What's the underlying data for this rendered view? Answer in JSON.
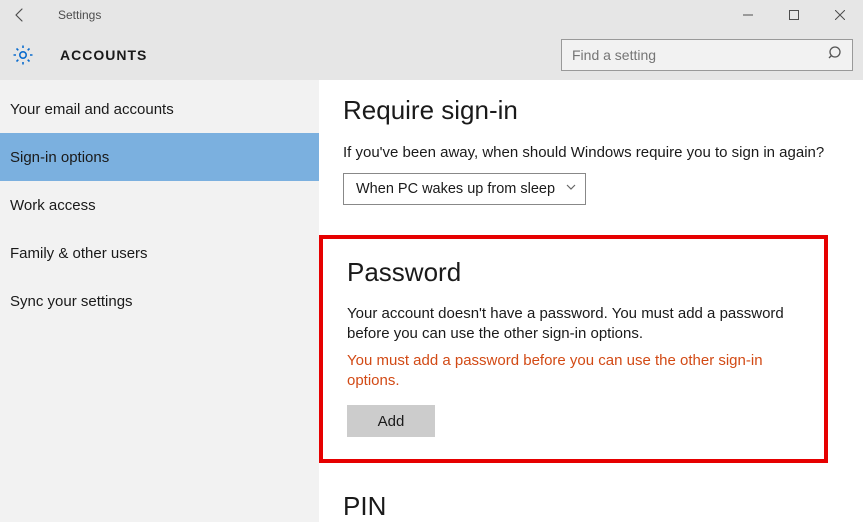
{
  "titlebar": {
    "title": "Settings"
  },
  "header": {
    "page_title": "ACCOUNTS",
    "search_placeholder": "Find a setting"
  },
  "sidebar": {
    "items": [
      {
        "label": "Your email and accounts",
        "active": false
      },
      {
        "label": "Sign-in options",
        "active": true
      },
      {
        "label": "Work access",
        "active": false
      },
      {
        "label": "Family & other users",
        "active": false
      },
      {
        "label": "Sync your settings",
        "active": false
      }
    ]
  },
  "content": {
    "require_signin": {
      "heading": "Require sign-in",
      "desc": "If you've been away, when should Windows require you to sign in again?",
      "dropdown_value": "When PC wakes up from sleep"
    },
    "password": {
      "heading": "Password",
      "desc": "Your account doesn't have a password. You must add a password before you can use the other sign-in options.",
      "warning": "You must add a password before you can use the other sign-in options.",
      "button": "Add"
    },
    "pin": {
      "heading": "PIN"
    }
  }
}
